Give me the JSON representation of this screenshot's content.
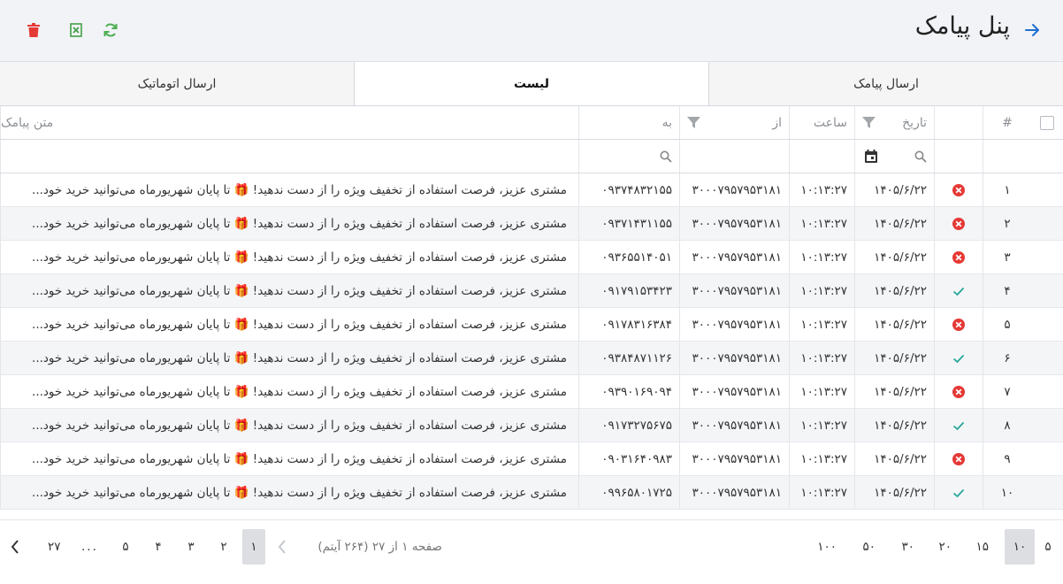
{
  "header": {
    "title": "پنل پیامک"
  },
  "tabs": [
    {
      "label": "ارسال پیامک",
      "active": false
    },
    {
      "label": "لیست",
      "active": true
    },
    {
      "label": "ارسال اتوماتیک",
      "active": false
    }
  ],
  "columns": {
    "num": "#",
    "date": "تاریخ",
    "time": "ساعت",
    "from": "از",
    "to": "به",
    "text": "متن پیامک"
  },
  "rows": [
    {
      "num": "۱",
      "status": "failed",
      "date": "۱۴۰۵/۶/۲۲",
      "time": "۱۰:۱۳:۲۷",
      "from": "۳۰۰۰۷۹۵۷۹۵۳۱۸۱",
      "to": "۰۹۳۷۴۸۳۲۱۵۵",
      "text": "مشتری عزیز، فرصت استفاده از تخفیف ویژه را از دست ندهید! 🎁 تا پایان شهریورماه می‌توانید خرید خود..."
    },
    {
      "num": "۲",
      "status": "failed",
      "date": "۱۴۰۵/۶/۲۲",
      "time": "۱۰:۱۳:۲۷",
      "from": "۳۰۰۰۷۹۵۷۹۵۳۱۸۱",
      "to": "۰۹۳۷۱۴۳۱۱۵۵",
      "text": "مشتری عزیز، فرصت استفاده از تخفیف ویژه را از دست ندهید! 🎁 تا پایان شهریورماه می‌توانید خرید خود..."
    },
    {
      "num": "۳",
      "status": "failed",
      "date": "۱۴۰۵/۶/۲۲",
      "time": "۱۰:۱۳:۲۷",
      "from": "۳۰۰۰۷۹۵۷۹۵۳۱۸۱",
      "to": "۰۹۳۶۵۵۱۴۰۵۱",
      "text": "مشتری عزیز، فرصت استفاده از تخفیف ویژه را از دست ندهید! 🎁 تا پایان شهریورماه می‌توانید خرید خود..."
    },
    {
      "num": "۴",
      "status": "success",
      "date": "۱۴۰۵/۶/۲۲",
      "time": "۱۰:۱۳:۲۷",
      "from": "۳۰۰۰۷۹۵۷۹۵۳۱۸۱",
      "to": "۰۹۱۷۹۱۵۳۴۲۳",
      "text": "مشتری عزیز، فرصت استفاده از تخفیف ویژه را از دست ندهید! 🎁 تا پایان شهریورماه می‌توانید خرید خود..."
    },
    {
      "num": "۵",
      "status": "failed",
      "date": "۱۴۰۵/۶/۲۲",
      "time": "۱۰:۱۳:۲۷",
      "from": "۳۰۰۰۷۹۵۷۹۵۳۱۸۱",
      "to": "۰۹۱۷۸۳۱۶۳۸۴",
      "text": "مشتری عزیز، فرصت استفاده از تخفیف ویژه را از دست ندهید! 🎁 تا پایان شهریورماه می‌توانید خرید خود..."
    },
    {
      "num": "۶",
      "status": "success",
      "date": "۱۴۰۵/۶/۲۲",
      "time": "۱۰:۱۳:۲۷",
      "from": "۳۰۰۰۷۹۵۷۹۵۳۱۸۱",
      "to": "۰۹۳۸۴۸۷۱۱۲۶",
      "text": "مشتری عزیز، فرصت استفاده از تخفیف ویژه را از دست ندهید! 🎁 تا پایان شهریورماه می‌توانید خرید خود..."
    },
    {
      "num": "۷",
      "status": "failed",
      "date": "۱۴۰۵/۶/۲۲",
      "time": "۱۰:۱۳:۲۷",
      "from": "۳۰۰۰۷۹۵۷۹۵۳۱۸۱",
      "to": "۰۹۳۹۰۱۶۹۰۹۴",
      "text": "مشتری عزیز، فرصت استفاده از تخفیف ویژه را از دست ندهید! 🎁 تا پایان شهریورماه می‌توانید خرید خود..."
    },
    {
      "num": "۸",
      "status": "success",
      "date": "۱۴۰۵/۶/۲۲",
      "time": "۱۰:۱۳:۲۷",
      "from": "۳۰۰۰۷۹۵۷۹۵۳۱۸۱",
      "to": "۰۹۱۷۳۲۷۵۶۷۵",
      "text": "مشتری عزیز، فرصت استفاده از تخفیف ویژه را از دست ندهید! 🎁 تا پایان شهریورماه می‌توانید خرید خود..."
    },
    {
      "num": "۹",
      "status": "failed",
      "date": "۱۴۰۵/۶/۲۲",
      "time": "۱۰:۱۳:۲۷",
      "from": "۳۰۰۰۷۹۵۷۹۵۳۱۸۱",
      "to": "۰۹۰۳۱۶۴۰۹۸۳",
      "text": "مشتری عزیز، فرصت استفاده از تخفیف ویژه را از دست ندهید! 🎁 تا پایان شهریورماه می‌توانید خرید خود..."
    },
    {
      "num": "۱۰",
      "status": "success",
      "date": "۱۴۰۵/۶/۲۲",
      "time": "۱۰:۱۳:۲۷",
      "from": "۳۰۰۰۷۹۵۷۹۵۳۱۸۱",
      "to": "۰۹۹۶۵۸۰۱۷۲۵",
      "text": "مشتری عزیز، فرصت استفاده از تخفیف ویژه را از دست ندهید! 🎁 تا پایان شهریورماه می‌توانید خرید خود..."
    }
  ],
  "pager": {
    "page_sizes": [
      "۵",
      "۱۰",
      "۱۵",
      "۲۰",
      "۳۰",
      "۵۰",
      "۱۰۰"
    ],
    "selected_page_size": "۱۰",
    "info": "صفحه ۱ از ۲۷ (۲۶۴ آیتم)",
    "pages": [
      "۱",
      "۲",
      "۳",
      "۴",
      "۵",
      "...",
      "۲۷"
    ],
    "current_page": "۱"
  },
  "colors": {
    "danger": "#e53935",
    "success": "#26a69a",
    "excel": "#43a047",
    "refresh": "#4caf50",
    "back_arrow": "#1e6fd0"
  },
  "icons": {
    "back": "arrow-right-icon",
    "delete": "trash-icon",
    "export": "excel-icon",
    "refresh": "refresh-icon",
    "filter": "filter-icon",
    "search": "search-icon",
    "calendar": "calendar-icon",
    "failed": "x-circle-icon",
    "success": "check-icon"
  }
}
